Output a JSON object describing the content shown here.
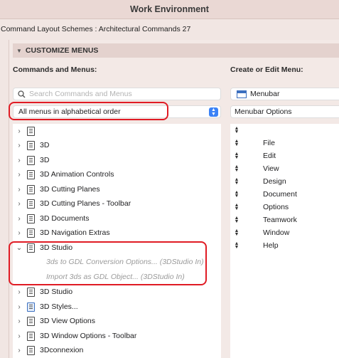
{
  "window": {
    "title": "Work Environment"
  },
  "scheme": {
    "text": "Command Layout Schemes :  Architectural Commands 27"
  },
  "section": {
    "title": "CUSTOMIZE MENUS"
  },
  "left": {
    "heading": "Commands and Menus:",
    "search_placeholder": "Search Commands and Menus",
    "filter_value": "All menus in alphabetical order",
    "rows": [
      {
        "label": "",
        "icon": "document-icon",
        "expanded": false
      },
      {
        "label": "3D",
        "icon": "document-icon",
        "expanded": false
      },
      {
        "label": "3D",
        "icon": "document-icon",
        "expanded": false
      },
      {
        "label": "3D Animation Controls",
        "icon": "document-icon",
        "expanded": false
      },
      {
        "label": "3D Cutting Planes",
        "icon": "document-icon",
        "expanded": false
      },
      {
        "label": "3D Cutting Planes - Toolbar",
        "icon": "document-icon",
        "expanded": false
      },
      {
        "label": "3D Documents",
        "icon": "document-icon",
        "expanded": false
      },
      {
        "label": "3D Navigation Extras",
        "icon": "document-icon",
        "expanded": false
      },
      {
        "label": "3D Studio",
        "icon": "document-icon",
        "expanded": true
      },
      {
        "label": "3D Studio",
        "icon": "document-icon",
        "expanded": false
      },
      {
        "label": "3D Styles...",
        "icon": "styles-icon",
        "expanded": false
      },
      {
        "label": "3D View Options",
        "icon": "document-icon",
        "expanded": false
      },
      {
        "label": "3D Window Options - Toolbar",
        "icon": "document-icon",
        "expanded": false
      },
      {
        "label": "3Dconnexion",
        "icon": "document-icon",
        "expanded": false
      }
    ],
    "children": [
      "3ds to GDL Conversion Options... (3DStudio In)",
      "Import 3ds as GDL Object... (3DStudio In)"
    ]
  },
  "right": {
    "heading": "Create or Edit Menu:",
    "menubar_value": "Menubar",
    "options_value": "Menubar Options",
    "items": [
      "",
      "File",
      "Edit",
      "View",
      "Design",
      "Document",
      "Options",
      "Teamwork",
      "Window",
      "Help"
    ]
  },
  "colors": {
    "highlight": "#e01b24",
    "accent": "#3b82f6",
    "background": "#f1e6e3"
  }
}
